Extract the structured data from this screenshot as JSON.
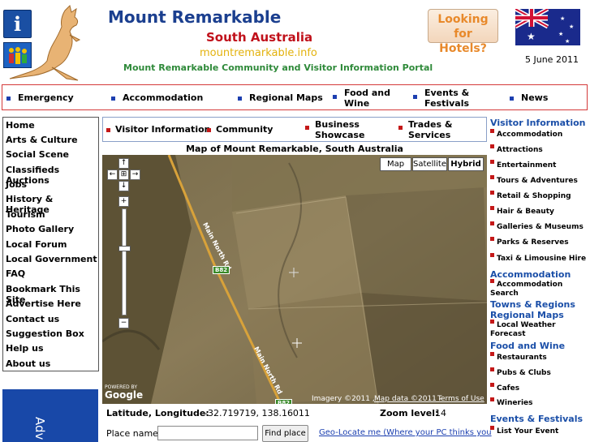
{
  "header": {
    "title": "Mount Remarkable",
    "subtitle": "South Australia",
    "domain": "mountremarkable.info",
    "tagline": "Mount Remarkable Community and Visitor Information Portal",
    "hotels_label_1": "Looking for",
    "hotels_label_2": "Hotels?",
    "date": "5 June 2011",
    "icons": [
      "info-icon",
      "family-icon",
      "kangaroo-logo",
      "australia-flag"
    ]
  },
  "topnav": [
    {
      "label": "Emergency"
    },
    {
      "label": "Accommodation"
    },
    {
      "label": "Regional Maps"
    },
    {
      "label": "Food and Wine"
    },
    {
      "label": "Events & Festivals"
    },
    {
      "label": "News"
    }
  ],
  "leftmenu": [
    "Home",
    "Arts & Culture",
    "Social Scene",
    "Classifieds Auctions",
    "Jobs",
    "History & Heritage",
    "Tourism",
    "Photo Gallery",
    "Local Forum",
    "Local Government",
    "FAQ",
    "Bookmark This Site",
    "Advertise Here",
    "Contact us",
    "Suggestion Box",
    "Help us",
    "About us"
  ],
  "ad": {
    "text": "Adv"
  },
  "subnav": [
    {
      "label": "Visitor Information"
    },
    {
      "label": "Community"
    },
    {
      "label": "Business Showcase"
    },
    {
      "label": "Trades & Services"
    }
  ],
  "map": {
    "title": "Map of Mount Remarkable, South Australia",
    "types": [
      "Map",
      "Satellite",
      "Hybrid"
    ],
    "selected_type": "Hybrid",
    "road_label": "Main North Rd",
    "road_shield": "B82",
    "attribution_imagery": "Imagery ©2011 ,",
    "attribution_data": "Map data ©2011 -",
    "terms": "Terms of Use",
    "powered_by": "POWERED BY",
    "logo": "Google",
    "controls": {
      "up": "↑",
      "left": "←",
      "center": "⊞",
      "right": "→",
      "down": "↓",
      "zoom_in": "+",
      "zoom_out": "−"
    },
    "zoom_level_fraction": 0.62
  },
  "coords": {
    "latlong_label": "Latitude, Longitude:",
    "latlong_value": "-32.719719, 138.16011",
    "zoom_label": "Zoom level:",
    "zoom_value": "14"
  },
  "search": {
    "place_label": "Place name:",
    "place_value": "",
    "find_label": "Find place",
    "geolocate_label": "Geo-Locate me (Where your PC thinks you"
  },
  "rightcol": [
    {
      "type": "head",
      "text": "Visitor Information"
    },
    {
      "type": "item",
      "text": "Accommodation"
    },
    {
      "type": "item",
      "text": "Attractions"
    },
    {
      "type": "item",
      "text": "Entertainment"
    },
    {
      "type": "item",
      "text": "Tours & Adventures"
    },
    {
      "type": "item",
      "text": "Retail & Shopping"
    },
    {
      "type": "item",
      "text": "Hair & Beauty"
    },
    {
      "type": "item",
      "text": "Galleries & Museums"
    },
    {
      "type": "item",
      "text": "Parks & Reserves"
    },
    {
      "type": "item",
      "text": "Taxi & Limousine Hire"
    },
    {
      "type": "head",
      "text": "Accommodation"
    },
    {
      "type": "item",
      "text": "Accommodation Search"
    },
    {
      "type": "head",
      "text": "Towns & Regions"
    },
    {
      "type": "head",
      "text": "Regional Maps"
    },
    {
      "type": "item",
      "text": "Local Weather Forecast"
    },
    {
      "type": "head",
      "text": "Food and Wine"
    },
    {
      "type": "item",
      "text": "Restaurants"
    },
    {
      "type": "item",
      "text": "Pubs & Clubs"
    },
    {
      "type": "item",
      "text": "Cafes"
    },
    {
      "type": "item",
      "text": "Wineries"
    },
    {
      "type": "head",
      "text": "Events & Festivals"
    },
    {
      "type": "item",
      "text": "List Your Event"
    }
  ],
  "colors": {
    "title_blue": "#1b3f8f",
    "subtitle_red": "#c0101a",
    "domain_gold": "#e3b20d",
    "tagline_green": "#2f8a3a",
    "link_blue": "#1b3fb0"
  }
}
